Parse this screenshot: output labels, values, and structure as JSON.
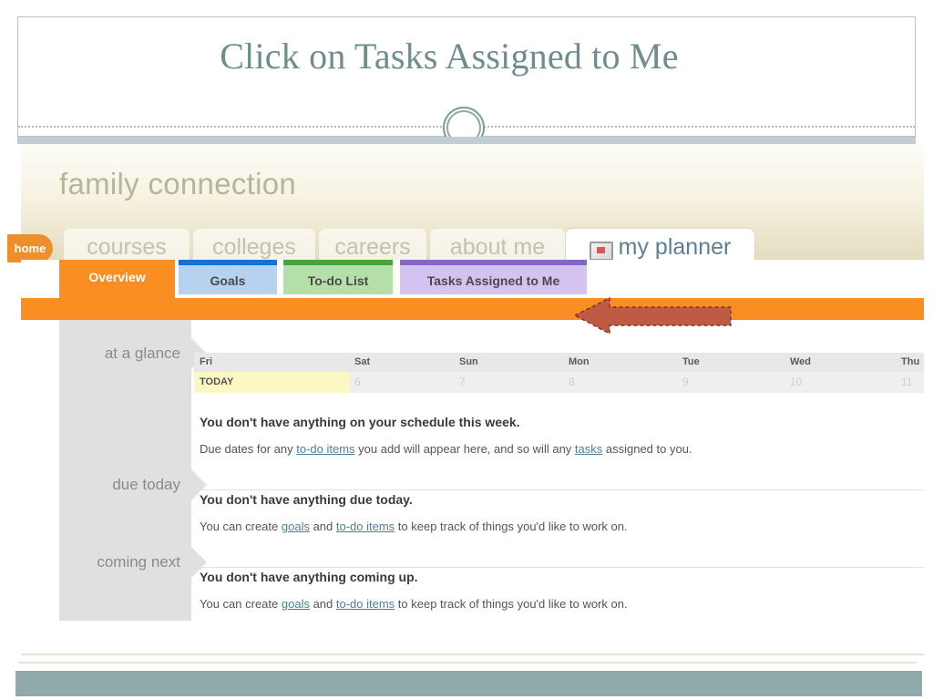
{
  "slide": {
    "title": "Click on Tasks Assigned to Me"
  },
  "app": {
    "brand": "family connection",
    "main_nav": [
      {
        "label": "home",
        "active": false
      },
      {
        "label": "courses",
        "active": false
      },
      {
        "label": "colleges",
        "active": false
      },
      {
        "label": "careers",
        "active": false
      },
      {
        "label": "about me",
        "active": false
      },
      {
        "label": "my planner",
        "active": true,
        "icon": "planner-icon"
      }
    ],
    "sub_tabs": [
      {
        "label": "Overview",
        "active": true,
        "color": "#fa8e22"
      },
      {
        "label": "Goals",
        "active": false,
        "color": "#1a6fd4"
      },
      {
        "label": "To-do List",
        "active": false,
        "color": "#4aa33e"
      },
      {
        "label": "Tasks Assigned to Me",
        "active": false,
        "color": "#8566c4"
      }
    ],
    "left_rail": [
      {
        "label": "at a glance"
      },
      {
        "label": "due today"
      },
      {
        "label": "coming next"
      }
    ],
    "week": {
      "days": [
        {
          "name": "Fri",
          "num": "TODAY",
          "today": true
        },
        {
          "name": "Sat",
          "num": "6",
          "today": false
        },
        {
          "name": "Sun",
          "num": "7",
          "today": false
        },
        {
          "name": "Mon",
          "num": "8",
          "today": false
        },
        {
          "name": "Tue",
          "num": "9",
          "today": false
        },
        {
          "name": "Wed",
          "num": "10",
          "today": false
        },
        {
          "name": "Thu",
          "num": "11",
          "today": false
        }
      ]
    },
    "blocks": {
      "glance": {
        "heading": "You don't have anything on your schedule this week.",
        "sub_pre": "Due dates for any ",
        "sub_link1": "to-do items",
        "sub_mid": " you add will appear here, and so will any ",
        "sub_link2": "tasks",
        "sub_post": " assigned to you."
      },
      "due_today": {
        "heading": "You don't have anything due today.",
        "sub_pre": "You can create ",
        "sub_link1": "goals",
        "sub_mid": " and ",
        "sub_link2": "to-do items",
        "sub_post": " to keep track of things you'd like to work on."
      },
      "coming_next": {
        "heading": "You don't have anything coming up.",
        "sub_pre": "You can create ",
        "sub_link1": "goals",
        "sub_mid": " and ",
        "sub_link2": "to-do items",
        "sub_post": " to keep track of things you'd like to work on."
      }
    },
    "annotation": {
      "arrow": "left-pointing-arrow",
      "arrow_color": "#bf5b44",
      "arrow_target": "Tasks Assigned to Me"
    },
    "colors": {
      "accent_orange": "#fa8e22",
      "green_edge": "#1aa11a",
      "footer_teal": "#90aaab",
      "title_teal": "#6e8d8c"
    }
  }
}
